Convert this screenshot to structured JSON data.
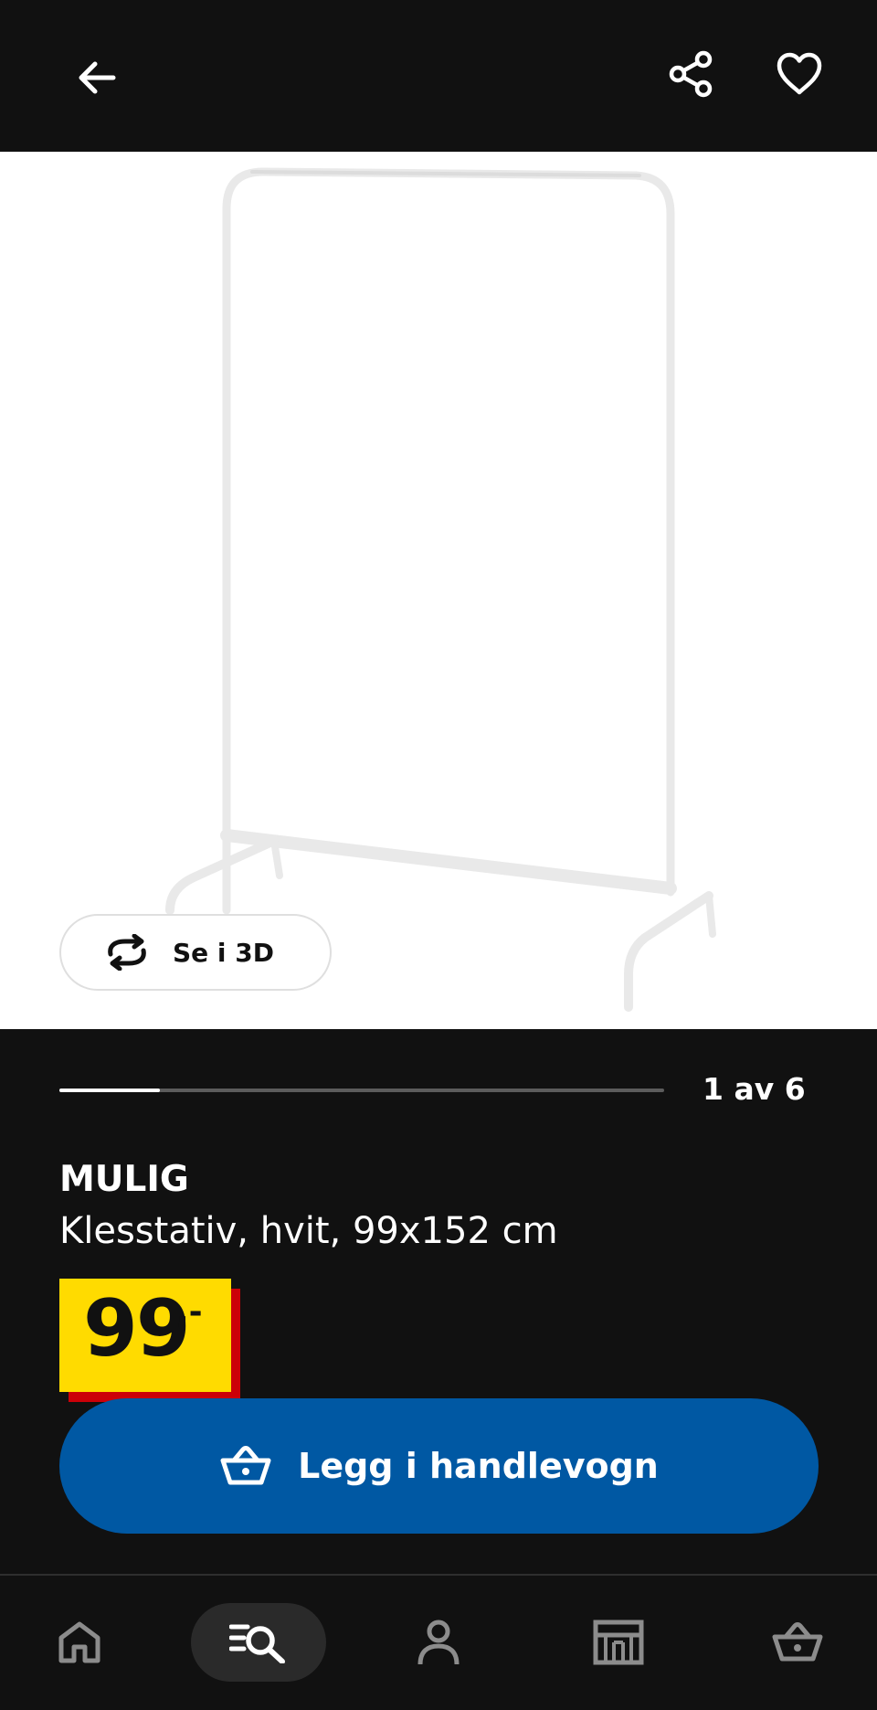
{
  "gallery": {
    "view_3d_label": "Se i 3D",
    "current_image": 1,
    "total_images": 6,
    "counter_text": "1 av 6"
  },
  "product": {
    "name": "MULIG",
    "description": "Klesstativ, hvit, 99x152 cm",
    "price": {
      "integer": "99",
      "suffix": ",-"
    }
  },
  "actions": {
    "add_to_cart_label": "Legg i handlevogn"
  },
  "icons": {
    "back": "arrow-left-icon",
    "share": "share-icon",
    "favorite": "heart-icon",
    "rotate_3d": "rotate-icon",
    "cart": "basket-icon",
    "nav_home": "home-icon",
    "nav_search": "search-icon",
    "nav_account": "user-icon",
    "nav_stores": "store-icon",
    "nav_cart": "basket-icon"
  },
  "colors": {
    "background": "#111111",
    "price_tag": "#ffdb00",
    "price_tag_shadow": "#cc0008",
    "primary_button": "#0058a3",
    "progress_track": "#5c5c5c",
    "progress_fill": "#ffffff"
  }
}
